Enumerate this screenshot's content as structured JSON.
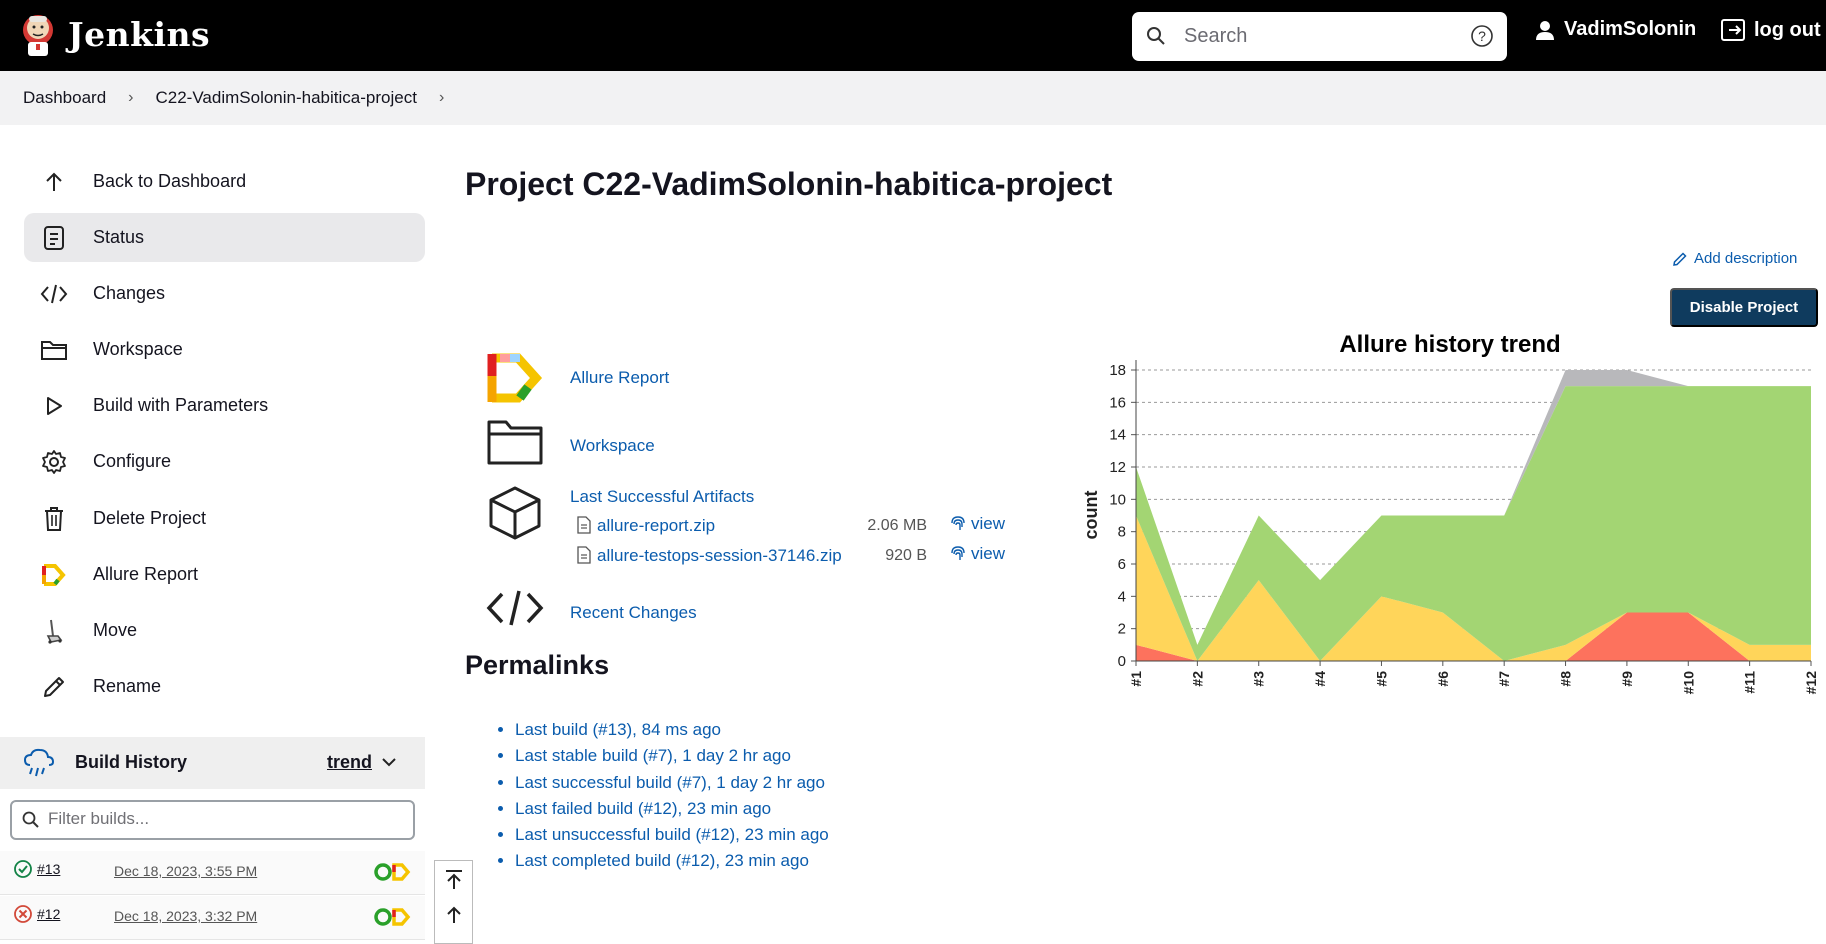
{
  "header": {
    "brand": "Jenkins",
    "search_placeholder": "Search",
    "user_name": "VadimSolonin",
    "logout_label": "log out"
  },
  "breadcrumb": {
    "items": [
      "Dashboard",
      "C22-VadimSolonin-habitica-project"
    ]
  },
  "sidebar": {
    "items": [
      {
        "label": "Back to Dashboard",
        "icon": "arrow-up-icon"
      },
      {
        "label": "Status",
        "icon": "document-icon"
      },
      {
        "label": "Changes",
        "icon": "code-icon"
      },
      {
        "label": "Workspace",
        "icon": "folder-icon"
      },
      {
        "label": "Build with Parameters",
        "icon": "play-icon"
      },
      {
        "label": "Configure",
        "icon": "gear-icon"
      },
      {
        "label": "Delete Project",
        "icon": "trash-icon"
      },
      {
        "label": "Allure Report",
        "icon": "allure-icon"
      },
      {
        "label": "Move",
        "icon": "move-icon"
      },
      {
        "label": "Rename",
        "icon": "pencil-icon"
      }
    ],
    "active": "Status"
  },
  "build_history": {
    "title": "Build History",
    "trend_label": "trend",
    "filter_placeholder": "Filter builds...",
    "builds": [
      {
        "number": "#13",
        "date": "Dec 18, 2023, 3:55 PM",
        "status": "success"
      },
      {
        "number": "#12",
        "date": "Dec 18, 2023, 3:32 PM",
        "status": "failed"
      }
    ]
  },
  "main": {
    "title": "Project C22-VadimSolonin-habitica-project",
    "add_description": "Add description",
    "disable_button": "Disable Project",
    "links": {
      "allure_report": "Allure Report",
      "workspace": "Workspace",
      "last_successful_artifacts": "Last Successful Artifacts",
      "recent_changes": "Recent Changes"
    },
    "artifacts": [
      {
        "name": "allure-report.zip",
        "size": "2.06 MB",
        "view": "view"
      },
      {
        "name": "allure-testops-session-37146.zip",
        "size": "920 B",
        "view": "view"
      }
    ],
    "permalinks_title": "Permalinks",
    "permalinks": [
      "Last build (#13), 84 ms ago",
      "Last stable build (#7), 1 day 2 hr ago",
      "Last successful build (#7), 1 day 2 hr ago",
      "Last failed build (#12), 23 min ago",
      "Last unsuccessful build (#12), 23 min ago",
      "Last completed build (#12), 23 min ago"
    ]
  },
  "chart_data": {
    "type": "area",
    "title": "Allure history trend",
    "ylabel": "count",
    "xlabel": "",
    "x": [
      "#1",
      "#2",
      "#3",
      "#4",
      "#5",
      "#6",
      "#7",
      "#8",
      "#9",
      "#10",
      "#11",
      "#12"
    ],
    "ylim": [
      0,
      18
    ],
    "yticks": [
      0,
      2,
      4,
      6,
      8,
      10,
      12,
      14,
      16,
      18
    ],
    "grid": true,
    "stacked": true,
    "series": [
      {
        "color": "#fd725d",
        "values": [
          1,
          0,
          0,
          0,
          0,
          0,
          0,
          0,
          3,
          3,
          0,
          0
        ]
      },
      {
        "color": "#ffd55a",
        "values": [
          8,
          0,
          5,
          0,
          4,
          3,
          0,
          1,
          0,
          0,
          1,
          1
        ]
      },
      {
        "color": "#a3d573",
        "values": [
          3,
          1,
          4,
          5,
          5,
          6,
          9,
          16,
          14,
          14,
          16,
          16
        ]
      },
      {
        "color": "#b8b8bb",
        "values": [
          0,
          0,
          0,
          0,
          0,
          0,
          0,
          1,
          1,
          0,
          0,
          0
        ]
      }
    ]
  }
}
